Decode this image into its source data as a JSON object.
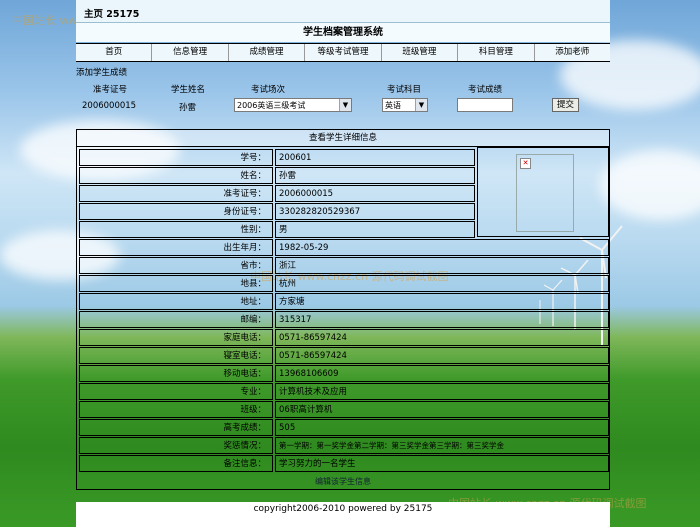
{
  "header": {
    "title": "主页  25175",
    "system_title": "学生档案管理系统"
  },
  "nav": [
    "首页",
    "信息管理",
    "成绩管理",
    "等级考试管理",
    "班级管理",
    "科目管理",
    "添加老师"
  ],
  "add_score": {
    "section_title": "添加学生成绩",
    "headers": {
      "ticket": "准考证号",
      "name": "学生姓名",
      "session": "考试场次",
      "subject": "考试科目",
      "score": "考试成绩"
    },
    "values": {
      "ticket": "2006000015",
      "name": "孙雷",
      "session": "2006英语三级考试",
      "subject": "英语",
      "score": ""
    },
    "submit_label": "提交"
  },
  "detail": {
    "title": "查看学生详细信息",
    "rows": [
      {
        "label": "学号：",
        "value": "200601"
      },
      {
        "label": "姓名：",
        "value": "孙雷"
      },
      {
        "label": "准考证号：",
        "value": "2006000015"
      },
      {
        "label": "身份证号：",
        "value": "330282820529367"
      },
      {
        "label": "性别：",
        "value": "男"
      },
      {
        "label": "出生年月：",
        "value": "1982-05-29"
      },
      {
        "label": "省市：",
        "value": "浙江"
      },
      {
        "label": "地县：",
        "value": "杭州"
      },
      {
        "label": "地址：",
        "value": "方家塘"
      },
      {
        "label": "邮编：",
        "value": "315317"
      },
      {
        "label": "家庭电话：",
        "value": "0571-86597424"
      },
      {
        "label": "寝室电话：",
        "value": "0571-86597424"
      },
      {
        "label": "移动电话：",
        "value": "13968106609"
      },
      {
        "label": "专业：",
        "value": "计算机技术及应用"
      },
      {
        "label": "班级：",
        "value": "06职高计算机"
      },
      {
        "label": "高考成绩：",
        "value": "505"
      },
      {
        "label": "奖惩情况：",
        "value": "第一学期：第一奖学金第二学期：第三奖学金第三学期：第三奖学金"
      },
      {
        "label": "备注信息：",
        "value": "学习努力的一名学生"
      }
    ],
    "edit_link": "编辑该学生信息"
  },
  "footer": "copyright2006-2010 powered by 25175",
  "watermark": "中国站长 www.cnzz.cn 源代码调试截图",
  "colors": {
    "sky_top": "#6fa6d8",
    "grass": "#3f9a2a",
    "panel": "#eef7fb"
  }
}
